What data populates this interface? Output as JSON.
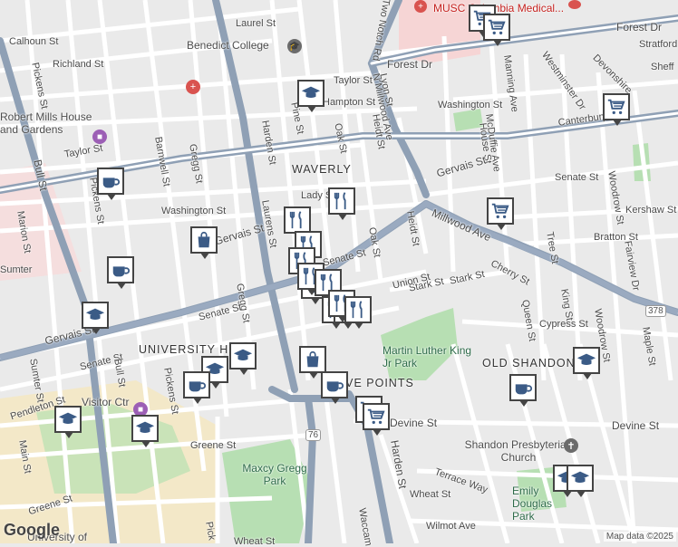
{
  "map": {
    "neighborhoods": [
      "WAVERLY",
      "UNIVERSITY HILL",
      "FIVE POINTS",
      "OLD SHANDON"
    ],
    "pois": {
      "benedict_college": "Benedict College",
      "robert_mills": "Robert Mills House and Gardens",
      "mlk_park": "Martin Luther King Jr Park",
      "maxcy_gregg_park": "Maxcy Gregg Park",
      "shandon_church": "Shandon Presbyterian Church",
      "emily_douglas_park": "Emily Douglas Park",
      "medical_center": "MUSC Columbia Medical...",
      "visitor_center": "Visitor Ctr",
      "university": "University of"
    },
    "streets": {
      "laurel_st": "Laurel St",
      "calhoun_st": "Calhoun St",
      "richland_st": "Richland St",
      "pickens_st": "Pickens St",
      "taylor_st": "Taylor St",
      "hampton_st": "Hampton St",
      "pine_st": "Pine St",
      "oak_st": "Oak St",
      "heidt_st": "Heidt St",
      "lady_st": "Lady St",
      "gervais_st": "Gervais St",
      "washington_st": "Washington St",
      "senate_st": "Senate St",
      "harden_st": "Harden St",
      "barnwell_st": "Barnwell St",
      "gregg_st": "Gregg St",
      "laurens_st": "Laurens St",
      "bull_st": "Bull St",
      "marion_st": "Marion St",
      "sumter_st": "Sumter St",
      "main_st": "Main St",
      "greene_st": "Greene St",
      "pendleton_st": "Pendleton St",
      "two_notch_rd": "Two Notch Rd",
      "n_millwood_ave": "N Millwood Ave",
      "lyon_st": "Lyon St",
      "forest_dr": "Forest Dr",
      "stratford": "Stratford",
      "sheff": "Sheff",
      "westminster_dr": "Westminster Dr",
      "devonshire": "Devonshire",
      "manning_ave": "Manning Ave",
      "canterbury_rd": "Canterbury Rd",
      "mcduffie_ave": "McDuffie Ave",
      "house_st": "House St",
      "millwood_ave": "Millwood Ave",
      "kershaw_st": "Kershaw St",
      "bratton_st": "Bratton St",
      "tree_st": "Tree St",
      "woodrow_st": "Woodrow St",
      "fairview_dr": "Fairview Dr",
      "stark_st": "Stark St",
      "cherry_st": "Cherry St",
      "queen_st": "Queen St",
      "king_st": "King St",
      "cypress_st": "Cypress St",
      "maple_st": "Maple St",
      "devine_st": "Devine St",
      "terrace_way": "Terrace Way",
      "wheat_st": "Wheat St",
      "wilmot_ave": "Wilmot Ave",
      "waccamaw": "Waccam",
      "pickens_short": "Pick",
      "union_short": "Union St",
      "sumter_left": "Sumter"
    },
    "shields": {
      "us76": "76",
      "us378": "378"
    },
    "copyright": "Map data ©2025",
    "logo": "Google"
  },
  "colors": {
    "background": "#eaeaea",
    "road": "#ffffff",
    "major_road": "#8fa0b5",
    "park": "#b7dfb3",
    "campus": "#f3e8c8",
    "medical": "#f6d5d5",
    "marker_border": "#444444"
  },
  "markers": [
    {
      "type": "grocery-icon"
    },
    {
      "type": "grocery-icon"
    },
    {
      "type": "education-icon"
    },
    {
      "type": "grocery-icon"
    },
    {
      "type": "coffee-icon"
    },
    {
      "type": "restaurant-icon"
    },
    {
      "type": "restaurant-icon"
    },
    {
      "type": "grocery-icon"
    },
    {
      "type": "shopping-icon"
    },
    {
      "type": "restaurant-icon"
    },
    {
      "type": "coffee-icon"
    },
    {
      "type": "restaurant-icon"
    },
    {
      "type": "shopping-icon"
    },
    {
      "type": "restaurant-icon"
    },
    {
      "type": "restaurant-icon"
    },
    {
      "type": "education-icon"
    },
    {
      "type": "restaurant-icon"
    },
    {
      "type": "restaurant-icon"
    },
    {
      "type": "restaurant-icon"
    },
    {
      "type": "restaurant-icon"
    },
    {
      "type": "education-icon"
    },
    {
      "type": "education-icon"
    },
    {
      "type": "shopping-icon"
    },
    {
      "type": "coffee-icon"
    },
    {
      "type": "education-icon"
    },
    {
      "type": "coffee-icon"
    },
    {
      "type": "coffee-icon"
    },
    {
      "type": "education-icon"
    },
    {
      "type": "education-icon"
    },
    {
      "type": "grocery-icon"
    },
    {
      "type": "grocery-icon"
    },
    {
      "type": "education-icon"
    },
    {
      "type": "education-icon"
    }
  ]
}
